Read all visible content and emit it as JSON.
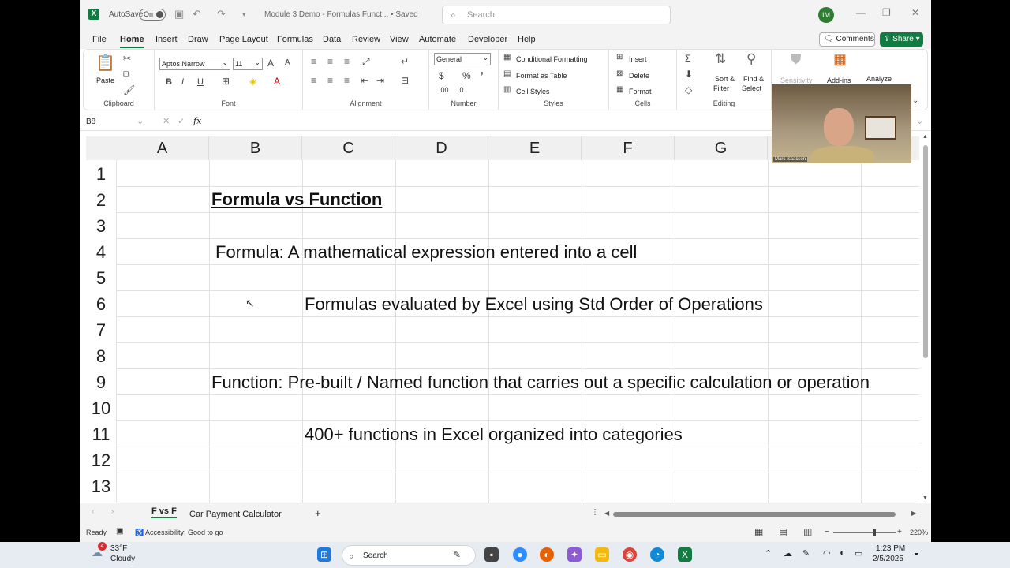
{
  "titlebar": {
    "autosave_label": "AutoSave",
    "autosave_toggle": "On",
    "doc_title": "Module 3 Demo - Formulas Funct... • Saved",
    "search_placeholder": "Search",
    "user_initials": "IM"
  },
  "menu": {
    "tabs": [
      "File",
      "Home",
      "Insert",
      "Draw",
      "Page Layout",
      "Formulas",
      "Data",
      "Review",
      "View",
      "Automate",
      "Developer",
      "Help"
    ],
    "active": "Home",
    "comments_label": "Comments",
    "share_label": "Share"
  },
  "ribbon": {
    "clipboard": {
      "label": "Clipboard",
      "paste": "Paste"
    },
    "font": {
      "label": "Font",
      "family": "Aptos Narrow",
      "size": "11"
    },
    "alignment": {
      "label": "Alignment"
    },
    "number": {
      "label": "Number",
      "format": "General"
    },
    "styles": {
      "label": "Styles",
      "conditional": "Conditional Formatting",
      "format_table": "Format as Table",
      "cell_styles": "Cell Styles"
    },
    "cells": {
      "label": "Cells",
      "insert": "Insert",
      "delete": "Delete",
      "format": "Format"
    },
    "editing": {
      "label": "Editing",
      "sort1": "Sort &",
      "sort2": "Filter",
      "find1": "Find &",
      "find2": "Select"
    },
    "sensitivity": "Sensitivity",
    "addins": "Add-ins",
    "analyze": "Analyze"
  },
  "formula_bar": {
    "name_box": "B8",
    "fx": "fx",
    "content": ""
  },
  "grid": {
    "columns": [
      "A",
      "B",
      "C",
      "D",
      "E",
      "F",
      "G"
    ],
    "rows": [
      "1",
      "2",
      "3",
      "4",
      "5",
      "6",
      "7",
      "8",
      "9",
      "10",
      "11",
      "12",
      "13"
    ],
    "cells": {
      "title": "Formula vs Function",
      "formula_def": "Formula:  A mathematical expression entered into a cell",
      "formula_note": "Formulas evaluated by Excel using Std Order of Operations",
      "function_def": "Function:  Pre-built / Named function that carries out a specific calculation or operation",
      "function_note": "400+ functions in Excel organized into categories"
    }
  },
  "camera": {
    "name": "Marc Isaacson"
  },
  "sheets": {
    "tabs": [
      "F vs F",
      "Car Payment Calculator"
    ],
    "active": "F vs F",
    "add": "+"
  },
  "status": {
    "ready": "Ready",
    "accessibility": "Accessibility: Good to go",
    "zoom": "220%"
  },
  "taskbar": {
    "temp": "33°F",
    "weather": "Cloudy",
    "weather_badge": "4",
    "search": "Search",
    "time": "1:23 PM",
    "date": "2/5/2025"
  },
  "colors": {
    "accent": "#107c41",
    "grid_line": "#e1e1e1"
  }
}
